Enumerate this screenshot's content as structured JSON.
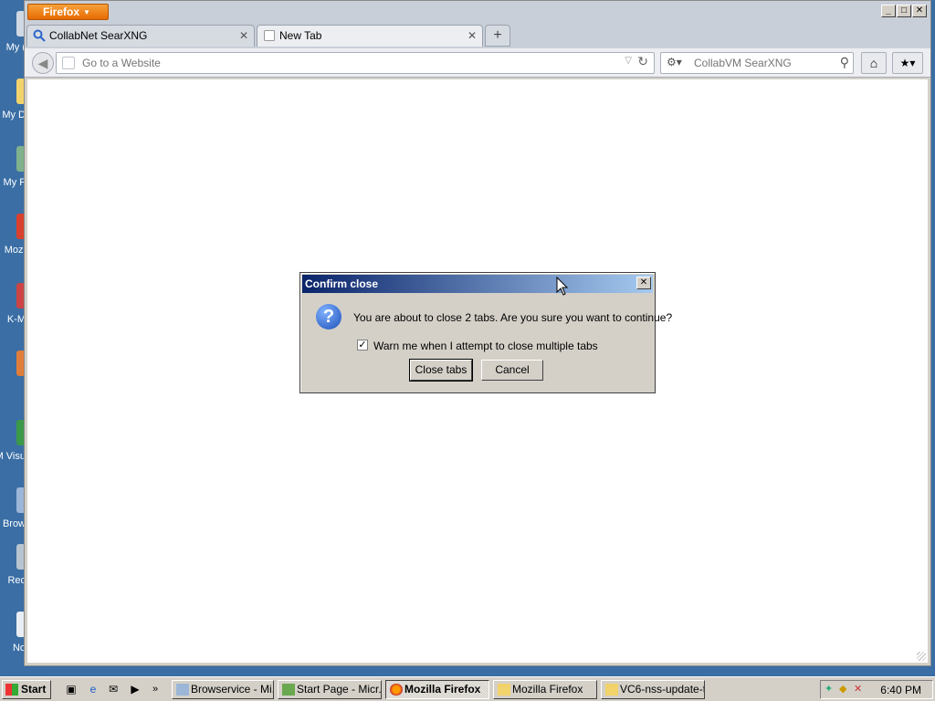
{
  "desktop": {
    "icons": [
      "My (",
      "My D",
      "My F",
      "Mozi",
      "K-M",
      "",
      "M Visu",
      "Brow",
      "Rec",
      "No"
    ]
  },
  "browser": {
    "app_button": "Firefox",
    "tabs": [
      {
        "label": "CollabNet SearXNG",
        "active": false
      },
      {
        "label": "New Tab",
        "active": true
      }
    ],
    "urlbar_placeholder": "Go to a Website",
    "search_placeholder": "CollabVM SearXNG"
  },
  "dialog": {
    "title": "Confirm close",
    "message": "You are about to close 2 tabs. Are you sure you want to continue?",
    "checkbox_label": "Warn me when I attempt to close multiple tabs",
    "checkbox_checked": true,
    "confirm_label": "Close tabs",
    "cancel_label": "Cancel"
  },
  "taskbar": {
    "start_label": "Start",
    "buttons": [
      {
        "label": "Browservice - Mi...",
        "active": false
      },
      {
        "label": "Start Page - Micr...",
        "active": false
      },
      {
        "label": "Mozilla Firefox",
        "active": true
      },
      {
        "label": "Mozilla Firefox",
        "active": false
      },
      {
        "label": "VC6-nss-update-t...",
        "active": false
      }
    ],
    "clock": "6:40 PM"
  },
  "colors": {
    "desktop": "#3a6ea5",
    "firefox_orange": "#e66a00",
    "dialog_title_start": "#0a246a",
    "dialog_title_end": "#a6caf0"
  }
}
